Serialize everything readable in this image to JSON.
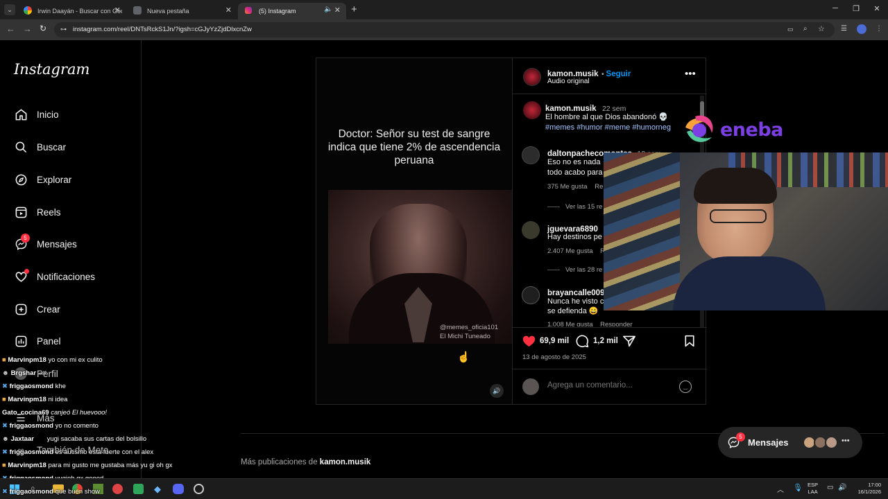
{
  "browser": {
    "tabs": [
      {
        "title": "Irwin Daayán - Buscar con Goo",
        "active": false
      },
      {
        "title": "Nueva pestaña",
        "active": false
      },
      {
        "title": "(5) Instagram",
        "active": true
      }
    ],
    "url": "instagram.com/reel/DNTsRckS1Jn/?igsh=cGJyYzZjdDlxcnZw"
  },
  "sidebar": {
    "logo": "Instagram",
    "items": [
      {
        "label": "Inicio",
        "icon": "home-icon"
      },
      {
        "label": "Buscar",
        "icon": "search-icon"
      },
      {
        "label": "Explorar",
        "icon": "compass-icon"
      },
      {
        "label": "Reels",
        "icon": "reels-icon"
      },
      {
        "label": "Mensajes",
        "icon": "messenger-icon",
        "badge": "5"
      },
      {
        "label": "Notificaciones",
        "icon": "heart-icon"
      },
      {
        "label": "Crear",
        "icon": "plus-icon"
      },
      {
        "label": "Panel",
        "icon": "chart-icon"
      },
      {
        "label": "Perfil",
        "icon": "avatar"
      },
      {
        "label": "Más",
        "icon": "menu-icon"
      },
      {
        "label": "También de Meta",
        "icon": "meta-icon"
      }
    ]
  },
  "post": {
    "video_caption": "Doctor: Señor su test de sangre indica que tiene 2% de ascendencia peruana",
    "watermark_1": "@memes_oficia101",
    "watermark_2": "El Michi Tuneado",
    "author": "kamon.musik",
    "follow": "Seguir",
    "audio": "Audio original",
    "caption_age": "22 sem",
    "caption_text": "El hombre al que Dios abandonó 💀",
    "caption_tags": "#memes #humor #meme #humorneg",
    "comments": [
      {
        "user": "daltonpachecomontes",
        "age": "13 sem",
        "text_1": "Eso no es nada",
        "text_2": "todo acabo para",
        "likes": "375 Me gusta",
        "reply": "Re",
        "replies_link": "Ver las 15 re"
      },
      {
        "user": "jguevara6890",
        "age": "2",
        "text_1": "Hay destinos pe",
        "text_2": "",
        "likes": "2.407 Me gusta",
        "reply": "R",
        "replies_link": "Ver las 28 re"
      },
      {
        "user": "brayancalle009",
        "age": "",
        "text_1": "Nunca he visto c",
        "text_2": "se defienda 😄",
        "likes": "1.008 Me gusta",
        "reply": "Responder",
        "replies_link": ""
      }
    ],
    "likes": "69,9 mil",
    "comments_count": "1,2 mil",
    "date": "13 de agosto de 2025",
    "comment_placeholder": "Agrega un comentario..."
  },
  "more_posts": {
    "prefix": "Más publicaciones de ",
    "author": "kamon.musik"
  },
  "messages_float": {
    "label": "Mensajes",
    "badge": "5"
  },
  "overlay": {
    "eneba": "eneba"
  },
  "chat": [
    {
      "user": "Marvinpm18",
      "msg": "yo con mi ex culito"
    },
    {
      "user": "Brgshar",
      "msg": "🏎"
    },
    {
      "user": "friggaosmond",
      "msg": "khe"
    },
    {
      "user": "Marvinpm18",
      "msg": "ni idea"
    },
    {
      "user": "Gato_cocina69",
      "msg": "canjeó El huevooo!"
    },
    {
      "user": "friggaosmond",
      "msg": "yo no comento"
    },
    {
      "user": "Jaxtaar",
      "msg": "yugi sacaba sus cartas del bolsillo"
    },
    {
      "user": "friggaosmond",
      "msg": "es autismo esta fuerte con el alex"
    },
    {
      "user": "Marvinpm18",
      "msg": "para mi gusto me gustaba más yu gi oh gx"
    },
    {
      "user": "friggaosmond",
      "msg": "yugioh gx goood"
    },
    {
      "user": "friggaosmond",
      "msg": "que buen show"
    }
  ],
  "taskbar": {
    "lang_1": "ESP",
    "lang_2": "LAA",
    "time": "17:00",
    "date": "16/1/2026"
  },
  "colors": {
    "like_red": "#ff3040",
    "follow_blue": "#0095f6",
    "bg": "#000000"
  }
}
